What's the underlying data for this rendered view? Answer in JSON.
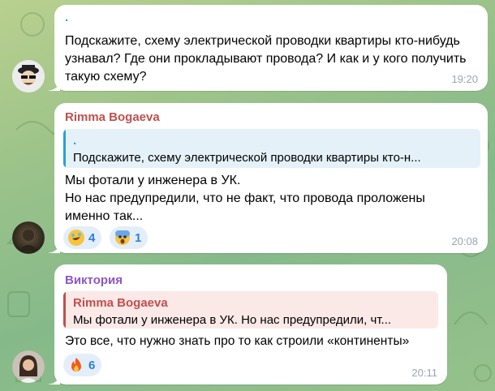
{
  "messages": [
    {
      "sender": ".",
      "text": "Подскажите, схему электрической проводки квартиры кто-нибудь узнавал? Где они прокладывают провода? И как и у кого получить такую схему?",
      "time": "19:20",
      "avatar": "man-with-sunglasses-avatar"
    },
    {
      "sender": "Rimma Bogaeva",
      "sender_color": "#c0504d",
      "reply": {
        "author": ".",
        "text": "Подскажите, схему электрической проводки квартиры кто-н...",
        "color": "#2aa0d6"
      },
      "text_lines": [
        "Мы фотали у инженера в УК.",
        "Но нас предупредили, что не факт, что провода проложены",
        "именно так..."
      ],
      "reactions": [
        {
          "emoji": "rofl-emoji",
          "count": "4"
        },
        {
          "emoji": "screaming-face-emoji",
          "count": "1"
        }
      ],
      "time": "20:08",
      "avatar": "dark-photo-avatar"
    },
    {
      "sender": "Виктория",
      "sender_color": "#8e55c4",
      "reply": {
        "author": "Rimma Bogaeva",
        "text": "Мы фотали у инженера в УК. Но нас предупредили, чт...",
        "color": "#c0504d"
      },
      "text": "Это все, что нужно знать про то как строили «континенты»",
      "reactions": [
        {
          "emoji": "fire-emoji",
          "count": "6"
        }
      ],
      "time": "20:11",
      "avatar": "woman-photo-avatar"
    }
  ]
}
